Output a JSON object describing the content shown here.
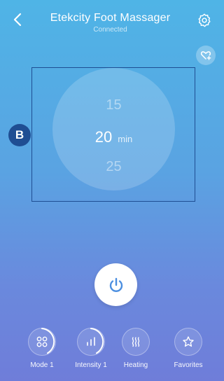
{
  "header": {
    "title": "Etekcity Foot Massager",
    "subtitle": "Connected"
  },
  "annotation": {
    "badge_label": "B"
  },
  "timer": {
    "prev_value": "15",
    "current_value": "20",
    "unit": "min",
    "next_value": "25"
  },
  "bottom_bar": [
    {
      "label": "Mode 1",
      "icon": "mode-icon"
    },
    {
      "label": "Intensity 1",
      "icon": "intensity-icon"
    },
    {
      "label": "Heating",
      "icon": "heating-icon"
    },
    {
      "label": "Favorites",
      "icon": "star-icon"
    }
  ]
}
